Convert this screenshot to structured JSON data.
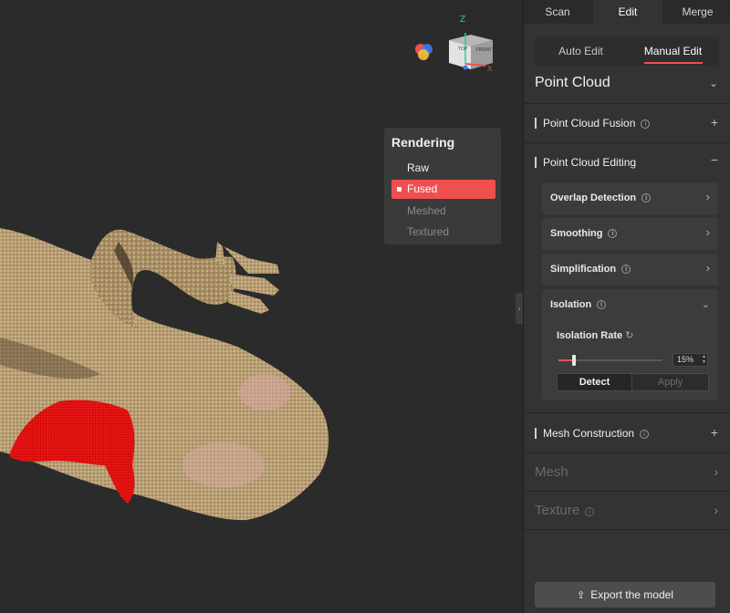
{
  "tabs": [
    {
      "label": "Scan"
    },
    {
      "label": "Edit"
    },
    {
      "label": "Merge"
    }
  ],
  "edit_mode": {
    "auto_label": "Auto Edit",
    "manual_label": "Manual Edit"
  },
  "gizmo": {
    "z_label": "Z",
    "x_label": "X",
    "face_top": "TOP",
    "face_front": "FRONT"
  },
  "rendering": {
    "title": "Rendering",
    "items": [
      {
        "label": "Raw"
      },
      {
        "label": "Fused"
      },
      {
        "label": "Meshed"
      },
      {
        "label": "Textured"
      }
    ],
    "selected": "Fused"
  },
  "point_cloud": {
    "title": "Point Cloud",
    "fusion_label": "Point Cloud Fusion",
    "editing_label": "Point Cloud Editing",
    "tools": [
      {
        "label": "Overlap Detection"
      },
      {
        "label": "Smoothing"
      },
      {
        "label": "Simplification"
      },
      {
        "label": "Isolation"
      }
    ],
    "isolation": {
      "rate_label": "Isolation Rate",
      "rate_value": "15%",
      "rate_fraction": 0.15,
      "detect_label": "Detect",
      "apply_label": "Apply"
    },
    "mesh_construction_label": "Mesh Construction"
  },
  "mesh": {
    "title": "Mesh"
  },
  "texture": {
    "title": "Texture"
  },
  "export": {
    "label": "Export the model"
  },
  "colors": {
    "accent": "#f04f4f",
    "panel_bg": "#333333",
    "viewport_bg": "#2b2b2b"
  }
}
